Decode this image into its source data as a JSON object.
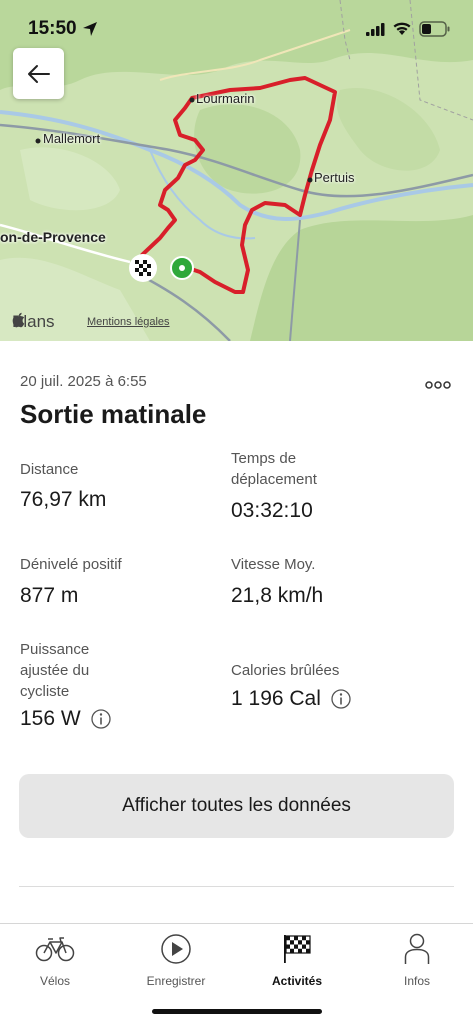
{
  "status_bar": {
    "time": "15:50"
  },
  "map": {
    "labels": {
      "lourmarin": "Lourmarin",
      "mallemort": "Mallemort",
      "pertuis": "Pertuis",
      "salon": "on-de-Provence"
    },
    "attribution": "Plans",
    "legal": "Mentions légales"
  },
  "activity": {
    "date": "20 juil. 2025 à 6:55",
    "more": "ooo",
    "title": "Sortie matinale",
    "stats": {
      "distance": {
        "label": "Distance",
        "value": "76,97 km"
      },
      "moving_time": {
        "label": "Temps de déplacement",
        "value": "03:32:10"
      },
      "elevation": {
        "label": "Dénivelé positif",
        "value": "877 m"
      },
      "avg_speed": {
        "label": "Vitesse Moy.",
        "value": "21,8 km/h"
      },
      "power": {
        "label": "Puissance ajustée du cycliste",
        "value": "156 W"
      },
      "calories": {
        "label": "Calories brûlées",
        "value": "1 196 Cal"
      }
    },
    "show_all": "Afficher toutes les données"
  },
  "tabs": [
    {
      "label": "Vélos",
      "icon": "bike-icon",
      "active": false
    },
    {
      "label": "Enregistrer",
      "icon": "play-icon",
      "active": false
    },
    {
      "label": "Activités",
      "icon": "checkered-flag-icon",
      "active": true
    },
    {
      "label": "Infos",
      "icon": "person-icon",
      "active": false
    }
  ],
  "colors": {
    "route": "#d81f2a",
    "start_marker": "#2fa83a",
    "map_green": "#cfe3b6",
    "button_bg": "#e6e6e6"
  }
}
